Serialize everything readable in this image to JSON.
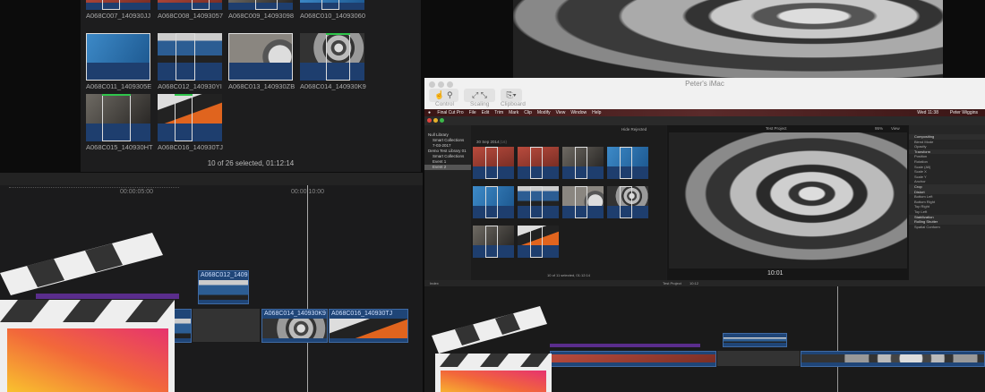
{
  "left_browser": {
    "clips": [
      {
        "name": "A068C007_140930JJ",
        "img": "red"
      },
      {
        "name": "A068C008_14093057",
        "img": "red"
      },
      {
        "name": "A068C009_14093098",
        "img": "gray"
      },
      {
        "name": "A068C010_14093060",
        "img": "blue"
      },
      {
        "name": "A068C011_1409305E",
        "img": "blue"
      },
      {
        "name": "A068C012_140930YI",
        "img": "car"
      },
      {
        "name": "A068C013_140930ZB",
        "img": "tire"
      },
      {
        "name": "A068C014_140930K9",
        "img": "wheel"
      },
      {
        "name": "A068C015_140930HT",
        "img": "gray"
      },
      {
        "name": "A068C016_140930TJ",
        "img": "orange"
      }
    ],
    "status": "10 of 26 selected, 01:12:14"
  },
  "left_timeline": {
    "ruler": [
      "00:00:05:00",
      "00:00:10:00"
    ],
    "connected_clip": "A068C012_140930YI",
    "clips": [
      "A068C014_140930K9",
      "A068C016_140930TJ"
    ]
  },
  "screen_share": {
    "title": "Peter's iMac",
    "toolbar": [
      "Control",
      "Scaling",
      "Clipboard"
    ]
  },
  "menubar": {
    "items": [
      "Final Cut Pro",
      "File",
      "Edit",
      "Trim",
      "Mark",
      "Clip",
      "Modify",
      "View",
      "Window",
      "Help"
    ],
    "clock": "Wed 11:38",
    "user": "Peter Wiggins"
  },
  "fcp": {
    "libraries": [
      "Null Library",
      "Smart Collections",
      "7-03-2017",
      "Demo Test Library 01",
      "Smart Collections",
      "Event 1",
      "Event 2"
    ],
    "hide_rejected": "Hide Rejected",
    "date_group": "30 Sep 2014",
    "date_count": "(16)",
    "browser_status": "10 of 11 selected, 01:12:14",
    "viewer_project": "Test Project",
    "zoom": "95%",
    "view": "View",
    "timecode": "10:01",
    "index": "Index",
    "timeline_project": "Test Project",
    "timeline_duration": "10:12",
    "inspector": [
      "Compositing",
      "Blend Mode",
      "Opacity",
      "Transform",
      "Position",
      "Rotation",
      "Scale (All)",
      "Scale X",
      "Scale Y",
      "Anchor",
      "Crop",
      "Distort",
      "Bottom Left",
      "Bottom Right",
      "Top Right",
      "Top Left",
      "Stabilization",
      "Rolling Shutter",
      "Spatial Conform"
    ],
    "inspector_sections": [
      "Compositing",
      "Transform",
      "Crop",
      "Distort",
      "Stabilization",
      "Rolling Shutter"
    ]
  },
  "colors": {
    "clip": "#1f4577",
    "accent": "#2fc54b",
    "connected": "#5a2d8c"
  }
}
